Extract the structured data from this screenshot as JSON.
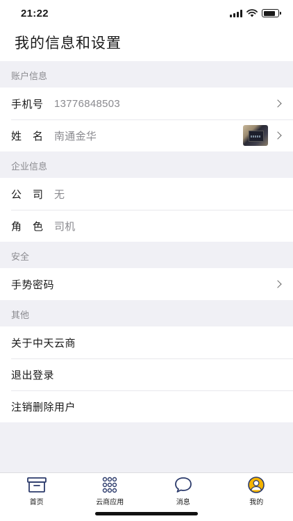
{
  "status_bar": {
    "time": "21:22"
  },
  "header": {
    "title": "我的信息和设置"
  },
  "sections": {
    "account": {
      "label": "账户信息",
      "phone": {
        "label": "手机号",
        "value": "13776848503"
      },
      "name": {
        "label": "姓　名",
        "value": "南通金华"
      }
    },
    "company": {
      "label": "企业信息",
      "company": {
        "label": "公　司",
        "value": "无"
      },
      "role": {
        "label": "角　色",
        "value": "司机"
      }
    },
    "security": {
      "label": "安全",
      "gesture": {
        "label": "手势密码"
      }
    },
    "other": {
      "label": "其他",
      "about": {
        "label": "关于中天云商"
      },
      "logout": {
        "label": "退出登录"
      },
      "delete": {
        "label": "注销删除用户"
      }
    }
  },
  "tabbar": {
    "home": {
      "label": "首页",
      "icon": "box-icon"
    },
    "apps": {
      "label": "云商应用",
      "icon": "grid-dots-icon"
    },
    "messages": {
      "label": "消息",
      "icon": "chat-bubble-icon"
    },
    "mine": {
      "label": "我的",
      "icon": "user-icon",
      "active": true
    }
  },
  "colors": {
    "active_tab": "#f5b400",
    "background": "#f0f0f5",
    "secondary_text": "#8a8a8f"
  }
}
